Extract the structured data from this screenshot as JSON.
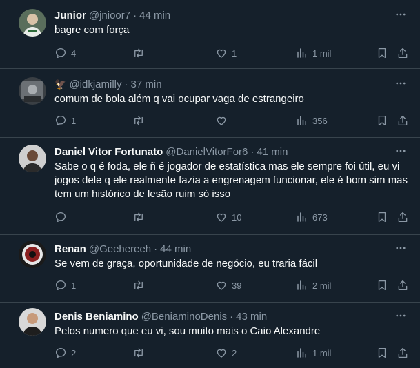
{
  "tweets": [
    {
      "name": "Junior",
      "emoji": "",
      "handle": "@jnioor7",
      "time": "44 min",
      "text": "bagre com força",
      "replies": "4",
      "retweets": "",
      "likes": "1",
      "views": "1 mil"
    },
    {
      "name": "",
      "emoji": "🦅",
      "handle": "@idkjamilly",
      "time": "37 min",
      "text": "comum de bola além q vai ocupar vaga de estrangeiro",
      "replies": "1",
      "retweets": "",
      "likes": "",
      "views": "356"
    },
    {
      "name": "Daniel Vitor Fortunato",
      "emoji": "",
      "handle": "@DanielVitorFor6",
      "time": "41 min",
      "text": "Sabe o q é foda, ele ñ é jogador de estatística mas ele sempre foi útil, eu vi jogos dele q ele realmente fazia a engrenagem funcionar, ele é bom sim mas tem um histórico de lesão ruim só isso",
      "replies": "",
      "retweets": "",
      "likes": "10",
      "views": "673"
    },
    {
      "name": "Renan",
      "emoji": "",
      "handle": "@Geehereeh",
      "time": "44 min",
      "text": "Se vem de graça, oportunidade de negócio, eu traria fácil",
      "replies": "1",
      "retweets": "",
      "likes": "39",
      "views": "2 mil"
    },
    {
      "name": "Denis Beniamino",
      "emoji": "",
      "handle": "@BeniaminoDenis",
      "time": "43 min",
      "text": "Pelos numero que eu vi, sou muito mais o Caio Alexandre",
      "replies": "2",
      "retweets": "",
      "likes": "2",
      "views": "1 mil"
    }
  ],
  "separator": "·",
  "colors": {
    "background": "#15202b",
    "text": "#f7f9f9",
    "secondary": "#8b98a5",
    "border": "#38444d"
  },
  "icons": {
    "reply": "reply-icon",
    "retweet": "retweet-icon",
    "like": "heart-icon",
    "views": "views-icon",
    "bookmark": "bookmark-icon",
    "share": "share-icon",
    "more": "more-icon"
  }
}
